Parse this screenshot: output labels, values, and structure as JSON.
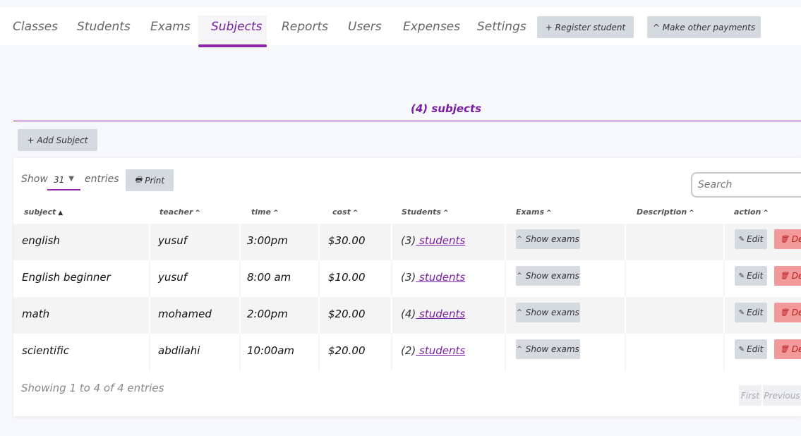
{
  "nav": {
    "tabs": [
      "Classes",
      "Students",
      "Exams",
      "Subjects",
      "Reports",
      "Users",
      "Expenses",
      "Settings"
    ],
    "active": "Subjects",
    "register_label": "+ Register student",
    "payments_label": "^ Make other payments"
  },
  "heading": {
    "count": "(4)",
    "title": "subjects"
  },
  "add_subject_label": "+ Add Subject",
  "table_controls": {
    "show_label": "Show",
    "entries_value": "31",
    "entries_label": "entries",
    "print_label": "Print",
    "search_placeholder": "Search"
  },
  "columns": [
    "subject",
    "teacher",
    "time",
    "cost",
    "Students",
    "Exams",
    "Description",
    "action"
  ],
  "rows": [
    {
      "subject": "english",
      "teacher": "yusuf",
      "time": "3:00pm",
      "cost": "$30.00",
      "students_count": "(3)",
      "students_link": " students",
      "exams_label": "Show exams",
      "description": ""
    },
    {
      "subject": "English beginner",
      "teacher": "yusuf",
      "time": "8:00 am",
      "cost": "$10.00",
      "students_count": "(3)",
      "students_link": " students",
      "exams_label": "Show exams",
      "description": ""
    },
    {
      "subject": "math",
      "teacher": "mohamed",
      "time": "2:00pm",
      "cost": "$20.00",
      "students_count": "(4)",
      "students_link": " students",
      "exams_label": "Show exams",
      "description": ""
    },
    {
      "subject": "scientific",
      "teacher": "abdilahi",
      "time": "10:00am",
      "cost": "$20.00",
      "students_count": "(2)",
      "students_link": " students",
      "exams_label": "Show exams",
      "description": ""
    }
  ],
  "row_actions": {
    "edit_label": "Edit",
    "delete_label": "Del"
  },
  "footer": {
    "info": "Showing 1 to 4 of 4 entries",
    "first_label": "First",
    "previous_label": "Previous"
  },
  "colors": {
    "accent": "#7b1fa2",
    "button_bg": "#d5d9e0",
    "delete_bg": "#f29a9a"
  }
}
